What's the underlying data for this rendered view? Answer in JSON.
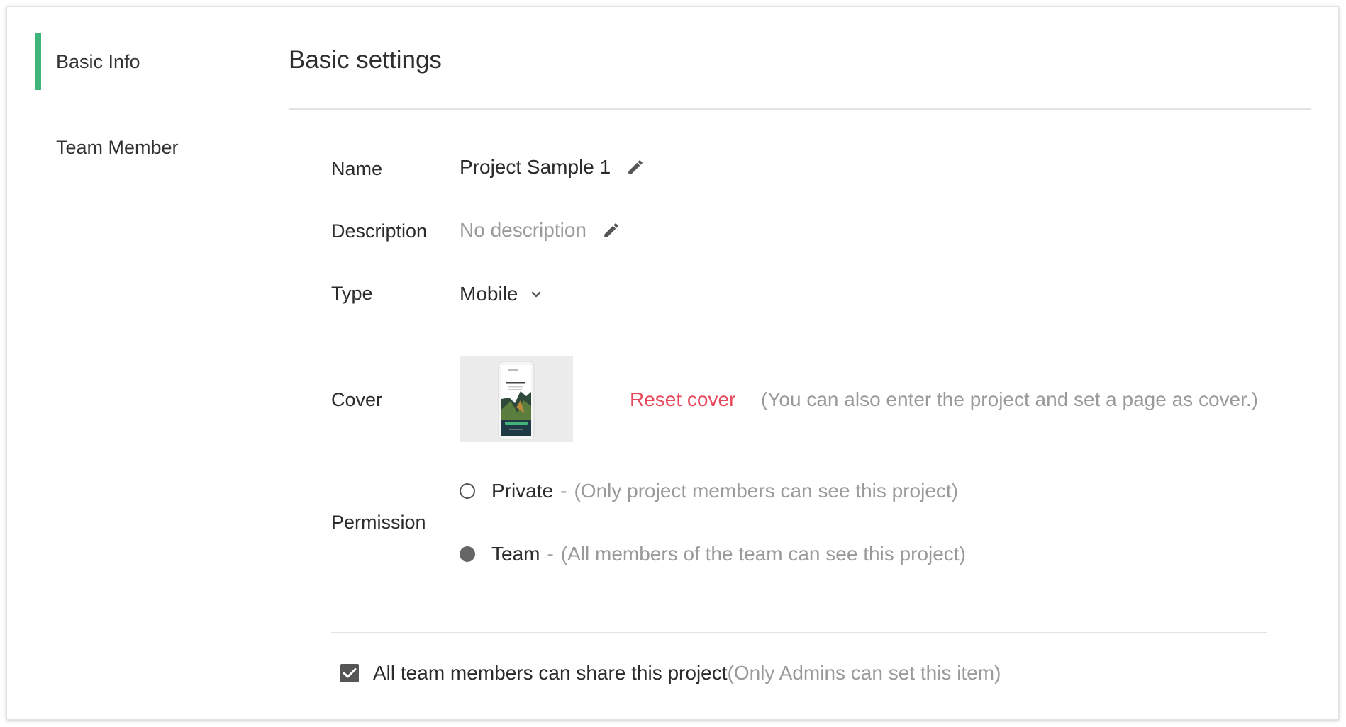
{
  "sidebar": {
    "items": [
      {
        "label": "Basic Info",
        "active": true
      },
      {
        "label": "Team Member",
        "active": false
      }
    ],
    "accent_color": "#3fb57c"
  },
  "main": {
    "title": "Basic settings",
    "fields": {
      "name": {
        "label": "Name",
        "value": "Project Sample 1",
        "icon": "pencil-icon"
      },
      "description": {
        "label": "Description",
        "placeholder": "No description",
        "icon": "pencil-icon"
      },
      "type": {
        "label": "Type",
        "value": "Mobile",
        "icon": "chevron-down-icon"
      },
      "cover": {
        "label": "Cover",
        "reset_label": "Reset cover",
        "hint": "(You can also enter the project and set a page as cover.)"
      },
      "permission": {
        "label": "Permission",
        "options": [
          {
            "label": "Private",
            "separator": "-",
            "description": "(Only project members can see this project)",
            "selected": false
          },
          {
            "label": "Team",
            "separator": "-",
            "description": "(All members of the team can see this project)",
            "selected": true
          }
        ]
      }
    },
    "share": {
      "label": "All team members can share this project",
      "note": "(Only Admins can set this item)",
      "checked": true
    }
  },
  "colors": {
    "link_red": "#e8485c",
    "muted_gray": "#9a9a9a"
  }
}
